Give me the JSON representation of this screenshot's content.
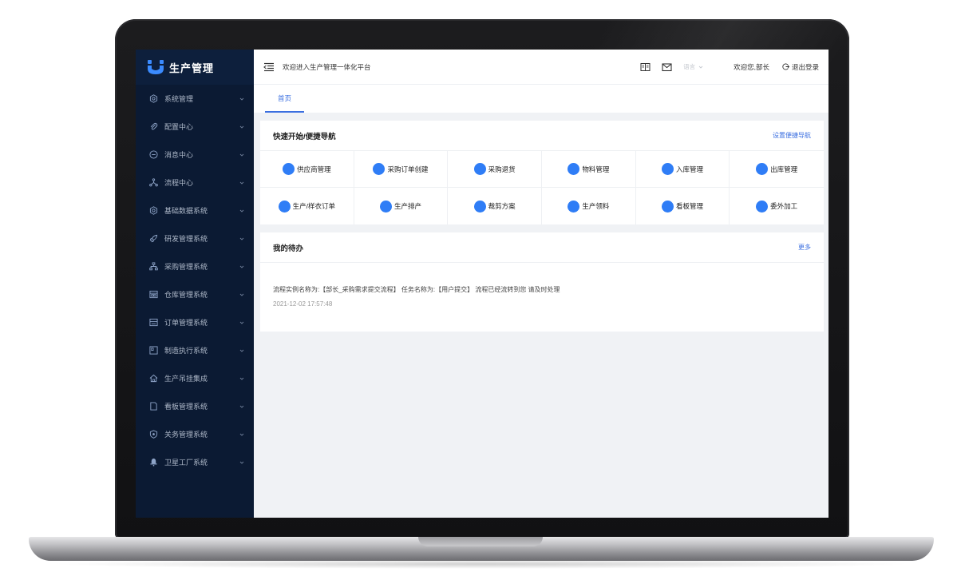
{
  "app": {
    "brand_name": "生产管理",
    "welcome_title": "欢迎进入生产管理一体化平台"
  },
  "sidebar": {
    "items": [
      {
        "label": "系统管理",
        "icon": "gear-icon"
      },
      {
        "label": "配置中心",
        "icon": "paperclip-icon"
      },
      {
        "label": "消息中心",
        "icon": "message-icon"
      },
      {
        "label": "流程中心",
        "icon": "flow-icon"
      },
      {
        "label": "基础数据系统",
        "icon": "gear-icon"
      },
      {
        "label": "研发管理系统",
        "icon": "rocket-icon"
      },
      {
        "label": "采购管理系统",
        "icon": "org-chart-icon"
      },
      {
        "label": "仓库管理系统",
        "icon": "warehouse-icon"
      },
      {
        "label": "订单管理系统",
        "icon": "order-icon"
      },
      {
        "label": "制造执行系统",
        "icon": "board-icon"
      },
      {
        "label": "生产吊挂集成",
        "icon": "home-icon"
      },
      {
        "label": "看板管理系统",
        "icon": "document-icon"
      },
      {
        "label": "关务管理系统",
        "icon": "shield-icon"
      },
      {
        "label": "卫星工厂系统",
        "icon": "bell-icon"
      }
    ]
  },
  "topbar": {
    "language_label": "语言",
    "greeting": "欢迎您,部长",
    "logout_label": "退出登录"
  },
  "tabs": [
    {
      "label": "首页",
      "active": true
    }
  ],
  "quick_nav": {
    "title": "快速开始/便捷导航",
    "settings_link": "设置便捷导航",
    "items": [
      {
        "label": "供应商管理"
      },
      {
        "label": "采购订单创建"
      },
      {
        "label": "采购退货"
      },
      {
        "label": "物料管理"
      },
      {
        "label": "入库管理"
      },
      {
        "label": "出库管理"
      },
      {
        "label": "生产/样衣订单"
      },
      {
        "label": "生产排产"
      },
      {
        "label": "裁剪方案"
      },
      {
        "label": "生产领料"
      },
      {
        "label": "看板管理"
      },
      {
        "label": "委外加工"
      }
    ]
  },
  "todo": {
    "title": "我的待办",
    "more_link": "更多",
    "items": [
      {
        "text": "流程实例名称为:【部长_采购需求提交流程】 任务名称为:【用户提交】 流程已经流转到您 请及时处理",
        "time": "2021-12-02 17:57:48"
      }
    ]
  },
  "colors": {
    "sidebar_bg": "#0b1a33",
    "accent": "#3b6fe0",
    "quick_dot": "#2f7df6",
    "content_bg": "#f0f2f5"
  }
}
